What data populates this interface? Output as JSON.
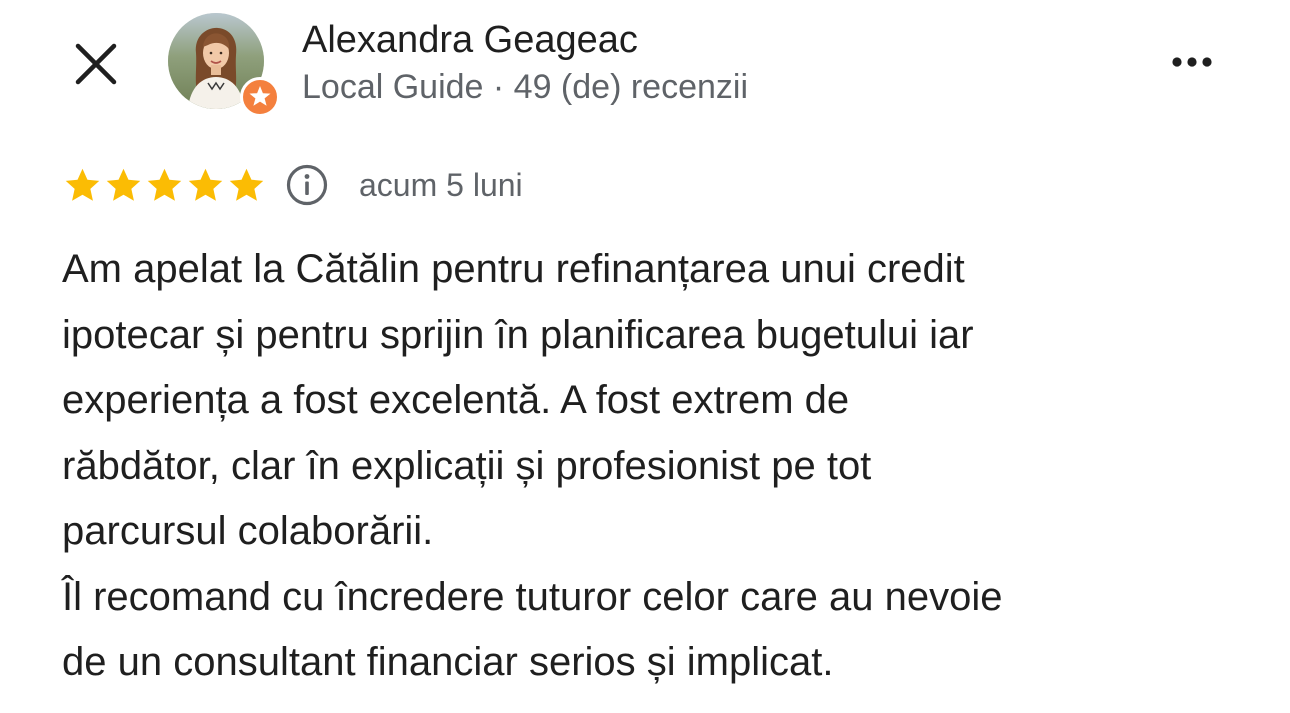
{
  "header": {
    "close_icon": "close-icon",
    "author_name": "Alexandra Geageac",
    "author_meta": "Local Guide · 49 (de) recenzii",
    "avatar_icon": "avatar-photo",
    "badge_icon": "local-guide-star-icon",
    "more_icon": "more-horizontal-icon"
  },
  "review": {
    "rating": 5,
    "rating_max": 5,
    "star_color": "#fbbc04",
    "info_icon": "info-icon",
    "date": "acum 5 luni",
    "lines": [
      "Am apelat la Cătălin pentru refinanțarea unui credit",
      "ipotecar și pentru sprijin în planificarea bugetului iar",
      "experiența a fost excelentă. A fost extrem de",
      "răbdător, clar în explicații și profesionist pe tot",
      "parcursul colaborării.",
      "Îl recomand cu încredere tuturor celor care au nevoie",
      "de un consultant financiar serios și implicat."
    ]
  },
  "colors": {
    "text_primary": "#1f1f1f",
    "text_secondary": "#5f6368",
    "badge_orange": "#f4803e",
    "background": "#ffffff"
  }
}
